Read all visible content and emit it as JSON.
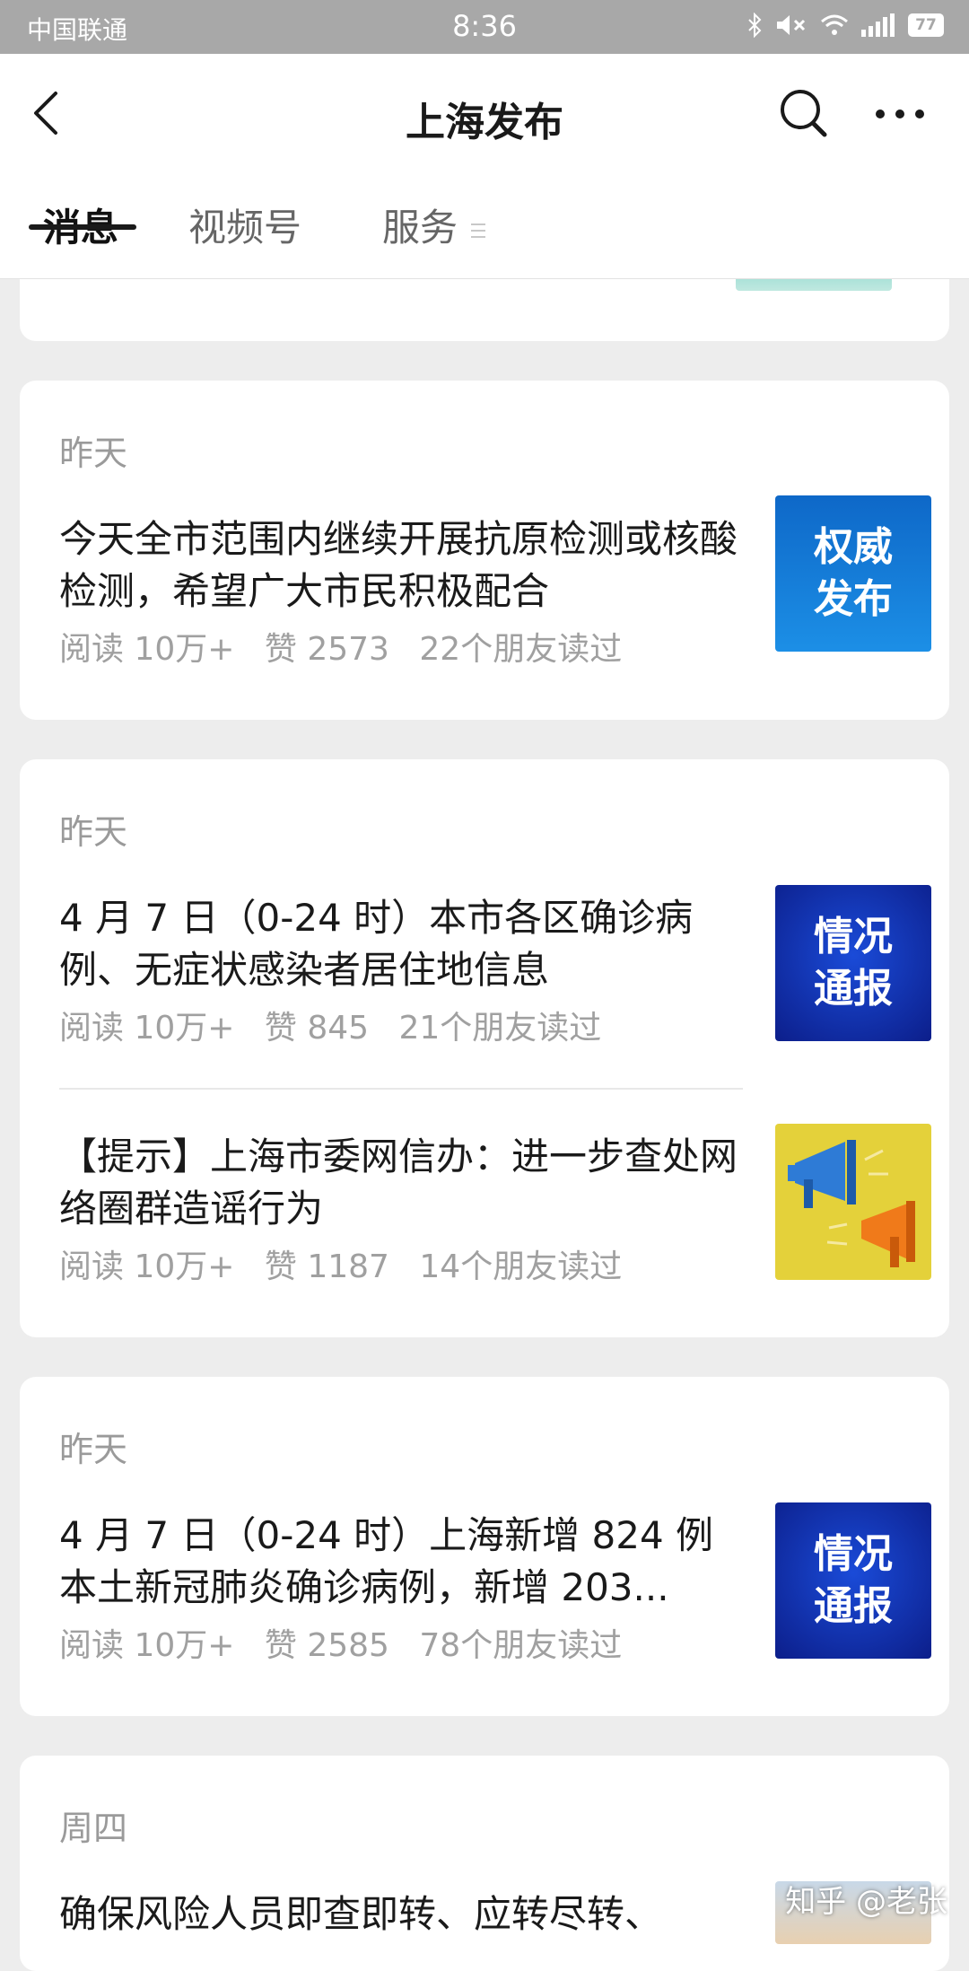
{
  "status_bar": {
    "carrier": "中国联通",
    "time": "8:36",
    "battery": "77",
    "icons": [
      "bluetooth-icon",
      "mute-icon",
      "wifi-icon",
      "signal-icon",
      "battery-icon"
    ]
  },
  "header": {
    "title": "上海发布",
    "back_icon": "back-arrow-icon",
    "search_icon": "search-icon",
    "more_icon": "more-icon"
  },
  "tabs": [
    {
      "label": "消息",
      "active": true
    },
    {
      "label": "视频号",
      "active": false
    },
    {
      "label": "服务",
      "active": false
    }
  ],
  "cards": [
    {
      "date": "昨天",
      "articles": [
        {
          "title": "今天全市范围内继续开展抗原检测或核酸检测，希望广大市民积极配合",
          "reads": "阅读 10万+",
          "likes": "赞 2573",
          "friends": "22个朋友读过",
          "thumb_text": "权威\n发布",
          "thumb_l1": "权威",
          "thumb_l2": "发布"
        }
      ]
    },
    {
      "date": "昨天",
      "articles": [
        {
          "title": "4 月 7 日（0-24 时）本市各区确诊病例、无症状感染者居住地信息",
          "reads": "阅读 10万+",
          "likes": "赞 845",
          "friends": "21个朋友读过",
          "thumb_l1": "情况",
          "thumb_l2": "通报"
        },
        {
          "title": "【提示】上海市委网信办：进一步查处网络圈群造谣行为",
          "reads": "阅读 10万+",
          "likes": "赞 1187",
          "friends": "14个朋友读过"
        }
      ]
    },
    {
      "date": "昨天",
      "articles": [
        {
          "title": "4 月 7 日（0-24 时）上海新增 824 例本土新冠肺炎确诊病例，新增 203...",
          "reads": "阅读 10万+",
          "likes": "赞 2585",
          "friends": "78个朋友读过",
          "thumb_l1": "情况",
          "thumb_l2": "通报"
        }
      ]
    },
    {
      "date": "周四",
      "articles": [
        {
          "title": "确保风险人员即查即转、应转尽转、"
        }
      ]
    }
  ],
  "watermark": "知乎 @老张"
}
